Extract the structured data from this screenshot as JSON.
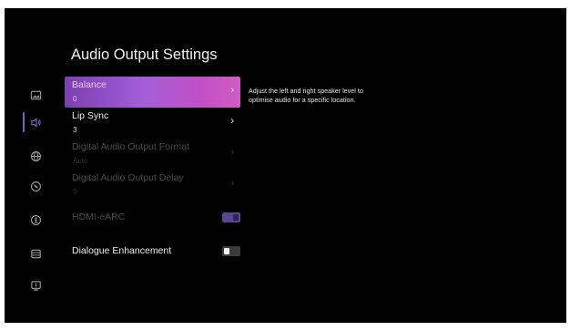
{
  "page": {
    "title": "Audio Output Settings",
    "description": "Adjust the left and right speaker level to optimise audio for a specific location."
  },
  "sidebar": {
    "items": [
      {
        "icon": "picture-icon",
        "active": false
      },
      {
        "icon": "sound-icon",
        "active": true
      },
      {
        "icon": "globe-icon",
        "active": false
      },
      {
        "icon": "compass-icon",
        "active": false
      },
      {
        "icon": "accessibility-icon",
        "active": false
      },
      {
        "icon": "storage-icon",
        "active": false
      },
      {
        "icon": "support-icon",
        "active": false
      }
    ]
  },
  "menu": {
    "balance": {
      "label": "Balance",
      "value": "0"
    },
    "lip_sync": {
      "label": "Lip Sync",
      "value": "3"
    },
    "digital_audio_output_format": {
      "label": "Digital Audio Output Format",
      "value": "Auto"
    },
    "digital_audio_output_delay": {
      "label": "Digital Audio Output Delay",
      "value": "0"
    },
    "hdmi_earc": {
      "label": "HDMI-eARC",
      "state": "on"
    },
    "dialogue_enhancement": {
      "label": "Dialogue Enhancement",
      "state": "off"
    },
    "chevron": "›"
  },
  "colors": {
    "background": "#000000",
    "accent": "#7a62c8",
    "selection_start": "#7c3fb2",
    "selection_end": "#d15ec4"
  }
}
